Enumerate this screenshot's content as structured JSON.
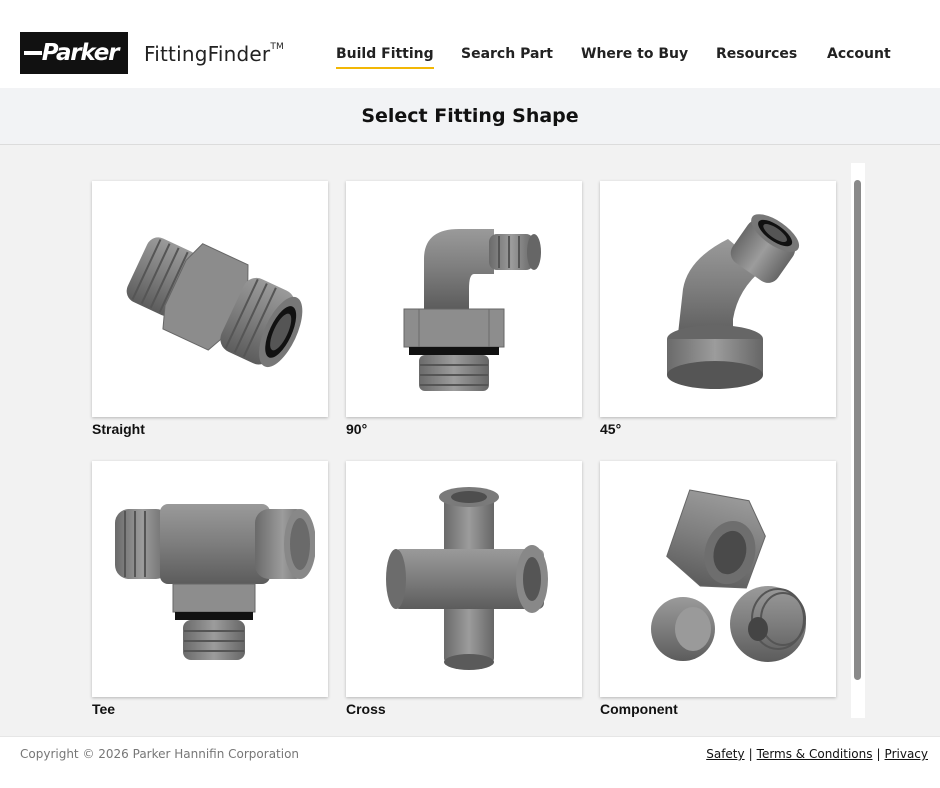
{
  "header": {
    "logo_text": "Parker",
    "app_name": "FittingFinder",
    "trademark": "TM",
    "nav": [
      {
        "label": "Build Fitting",
        "active": true
      },
      {
        "label": "Search Part",
        "active": false
      },
      {
        "label": "Where to Buy",
        "active": false
      },
      {
        "label": "Resources",
        "active": false
      },
      {
        "label": "Account",
        "active": false
      }
    ],
    "accent_color": "#f2b705"
  },
  "page_title": "Select Fitting Shape",
  "shapes": [
    {
      "label": "Straight",
      "icon": "straight-fitting-icon"
    },
    {
      "label": "90°",
      "icon": "elbow-90-fitting-icon"
    },
    {
      "label": "45°",
      "icon": "elbow-45-fitting-icon"
    },
    {
      "label": "Tee",
      "icon": "tee-fitting-icon"
    },
    {
      "label": "Cross",
      "icon": "cross-fitting-icon"
    },
    {
      "label": "Component",
      "icon": "component-fitting-icon"
    }
  ],
  "footer": {
    "copyright": "Copyright © 2026 Parker Hannifin Corporation",
    "links": [
      "Safety",
      "Terms & Conditions",
      "Privacy"
    ]
  }
}
